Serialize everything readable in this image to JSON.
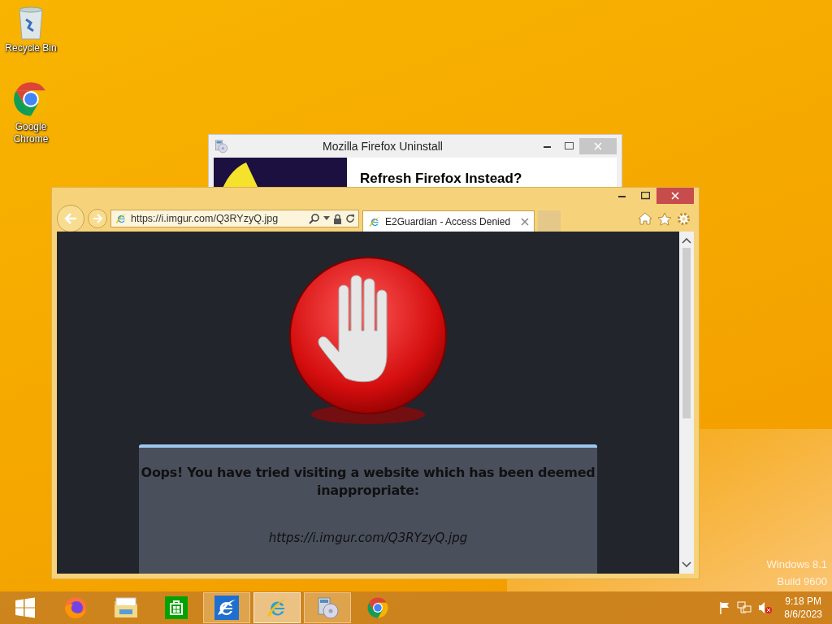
{
  "desktop_icons": [
    {
      "kind": "recycle-bin",
      "label": "Recycle Bin"
    },
    {
      "kind": "chrome",
      "label": "Google Chrome"
    }
  ],
  "back_window": {
    "title": "Mozilla Firefox Uninstall",
    "heading": "Refresh Firefox Instead?"
  },
  "browser": {
    "address": "https://i.imgur.com/Q3RYzyQ.jpg",
    "tabs": [
      {
        "label": "E2Guardian - Access Denied",
        "selected": true
      }
    ],
    "message": "Oops! You have tried visiting a website which has been deemed inappropriate:",
    "blocked_url": "https://i.imgur.com/Q3RYzyQ.jpg"
  },
  "taskbar": {
    "items": [
      {
        "kind": "start",
        "open": false,
        "selected": false
      },
      {
        "kind": "firefox",
        "open": false,
        "selected": false
      },
      {
        "kind": "explorer",
        "open": false,
        "selected": false
      },
      {
        "kind": "store",
        "open": false,
        "selected": false
      },
      {
        "kind": "ie-tile",
        "open": true,
        "selected": false
      },
      {
        "kind": "ie",
        "open": true,
        "selected": true
      },
      {
        "kind": "installer",
        "open": true,
        "selected": false
      },
      {
        "kind": "chrome",
        "open": false,
        "selected": false
      }
    ],
    "time": "9:18 PM",
    "date": "8/6/2023"
  },
  "watermark": [
    "Windows 8.1",
    "Build 9600"
  ]
}
